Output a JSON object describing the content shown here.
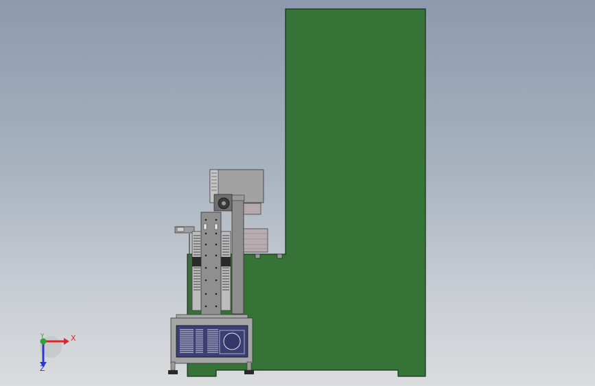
{
  "triad": {
    "x_label": "X",
    "y_label": "Y",
    "z_label": "Z",
    "colors": {
      "x": "#e0242a",
      "y": "#2fa33a",
      "z": "#2a37d6"
    }
  },
  "colors": {
    "frame_green": "#357337",
    "frame_outline": "#0d1a0d",
    "machine_gray": "#8e8e8e",
    "panel_blue": "#3c3f74",
    "background_top": "#8d9aae",
    "background_bottom": "#dadcde"
  }
}
